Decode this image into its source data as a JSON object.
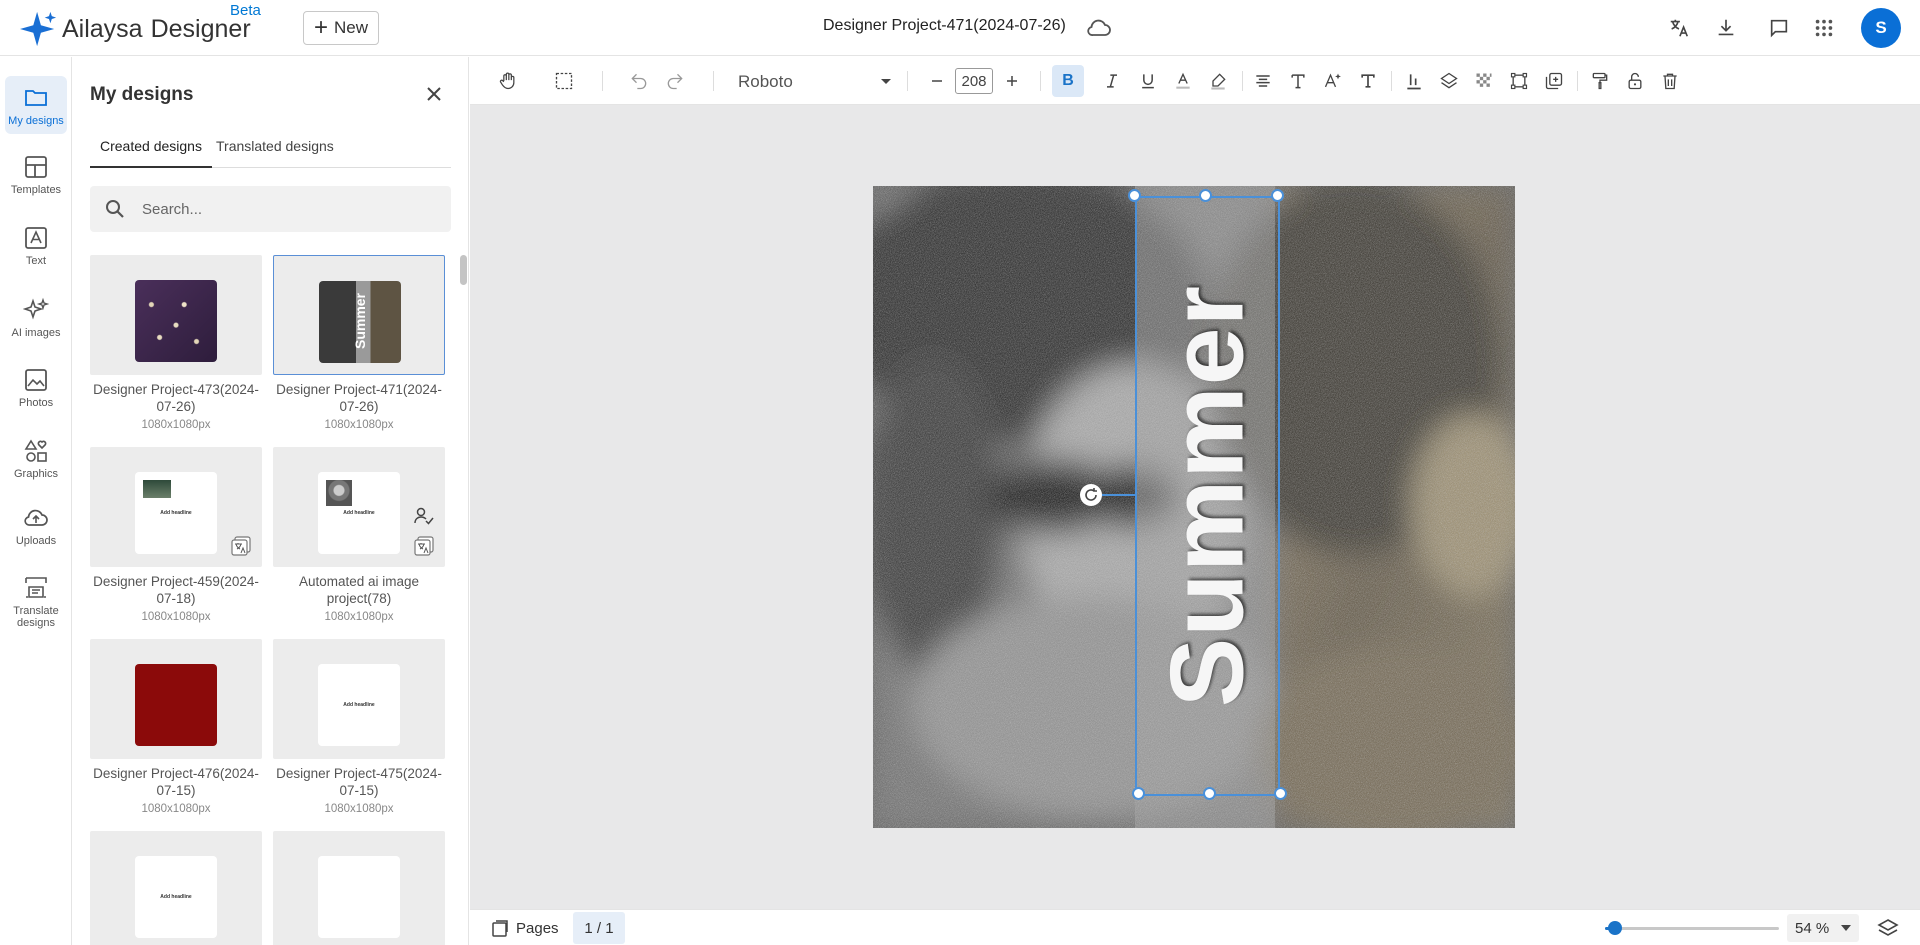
{
  "header": {
    "brand_primary": "Ailaysa",
    "brand_secondary": "Designer",
    "beta_label": "Beta",
    "new_button_label": "New",
    "project_title": "Designer Project-471(2024-07-26)",
    "avatar_initial": "S",
    "icons": [
      "translate-icon",
      "download-icon",
      "comment-icon",
      "apps-grid-icon"
    ]
  },
  "rail": {
    "items": [
      {
        "label": "My designs",
        "icon": "folder-icon",
        "active": true
      },
      {
        "label": "Templates",
        "icon": "templates-icon"
      },
      {
        "label": "Text",
        "icon": "text-icon"
      },
      {
        "label": "AI images",
        "icon": "sparkle-icon"
      },
      {
        "label": "Photos",
        "icon": "photo-icon"
      },
      {
        "label": "Graphics",
        "icon": "shapes-icon"
      },
      {
        "label": "Uploads",
        "icon": "cloud-upload-icon"
      },
      {
        "label": "Translate designs",
        "icon": "translate-designs-icon"
      }
    ]
  },
  "panel": {
    "title": "My designs",
    "tabs": [
      {
        "label": "Created designs",
        "active": true
      },
      {
        "label": "Translated designs"
      }
    ],
    "search_placeholder": "Search...",
    "designs": [
      {
        "name": "Designer Project-473(2024-07-26)",
        "size": "1080x1080px",
        "thumb": "flowers"
      },
      {
        "name": "Designer Project-471(2024-07-26)",
        "size": "1080x1080px",
        "thumb": "summer",
        "selected": true,
        "thumb_text": "Summer"
      },
      {
        "name": "Designer Project-459(2024-07-18)",
        "size": "1080x1080px",
        "thumb": "white-img",
        "thumb_text": "Add headline"
      },
      {
        "name": "Automated ai image project(78)",
        "size": "1080x1080px",
        "thumb": "white-img2",
        "thumb_text": "Add headline"
      },
      {
        "name": "Designer Project-476(2024-07-15)",
        "size": "1080x1080px",
        "thumb": "red"
      },
      {
        "name": "Designer Project-475(2024-07-15)",
        "size": "1080x1080px",
        "thumb": "white-text",
        "thumb_text": "Add headline"
      },
      {
        "name": "",
        "size": "",
        "thumb": "white-text",
        "thumb_text": "Add headline"
      },
      {
        "name": "",
        "size": "",
        "thumb": "white"
      }
    ]
  },
  "toolbar": {
    "font_family": "Roboto",
    "font_size": "208",
    "bold_label": "B"
  },
  "canvas": {
    "text_content": "Summer"
  },
  "footer": {
    "pages_label": "Pages",
    "page_count": "1 / 1",
    "zoom_value": "54 %",
    "zoom_fraction": 0.06
  },
  "colors": {
    "accent": "#0a6fd6",
    "selection": "#4a90d9"
  }
}
